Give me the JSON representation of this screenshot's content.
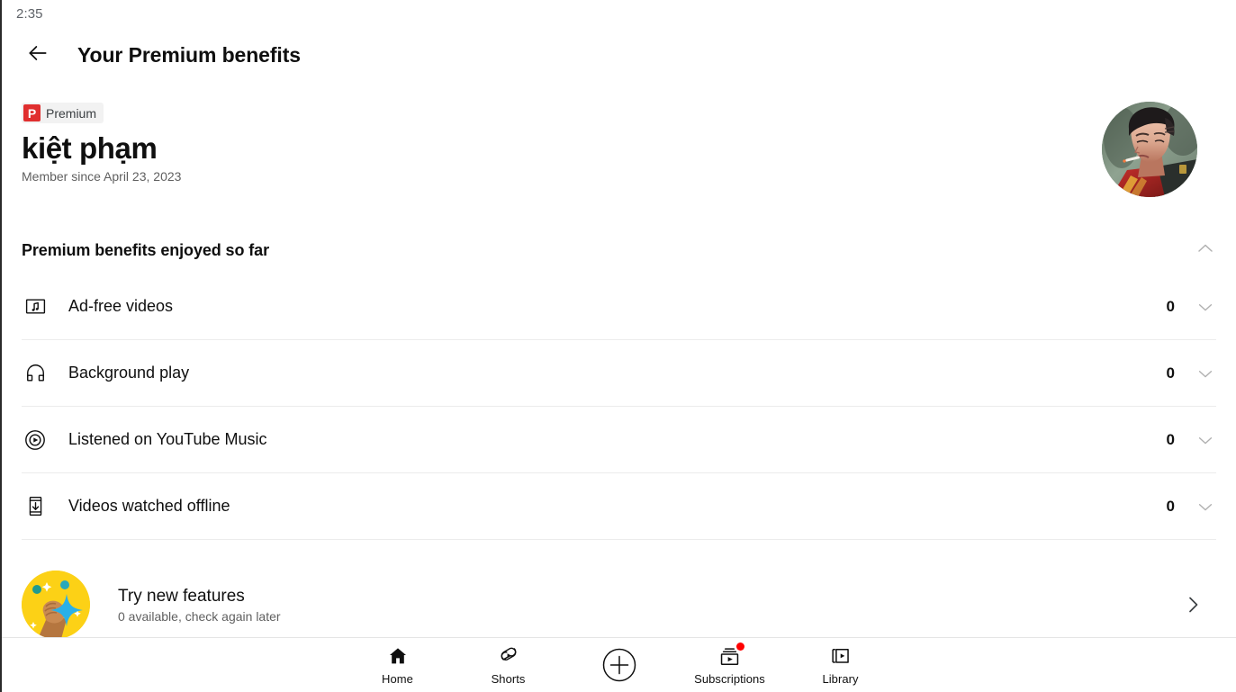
{
  "status_bar": {
    "time": "2:35"
  },
  "app_bar": {
    "back_icon": "arrow-left-icon",
    "title": "Your Premium benefits"
  },
  "profile": {
    "badge": {
      "logo_letter": "P",
      "label": "Premium",
      "logo_color": "#e02f2f",
      "pill_bg": "#f2f2f2"
    },
    "name": "kiệt phạm",
    "member_since": "Member since April 23, 2023",
    "avatar_alt": "user-avatar"
  },
  "benefits_section": {
    "title": "Premium benefits enjoyed so far",
    "collapse_icon": "chevron-up-icon",
    "rows": [
      {
        "icon": "ad-free-video-icon",
        "label": "Ad-free videos",
        "count": "0",
        "expand_icon": "chevron-down-icon"
      },
      {
        "icon": "headphones-icon",
        "label": "Background play",
        "count": "0",
        "expand_icon": "chevron-down-icon"
      },
      {
        "icon": "youtube-music-icon",
        "label": "Listened on YouTube Music",
        "count": "0",
        "expand_icon": "chevron-down-icon"
      },
      {
        "icon": "download-offline-icon",
        "label": "Videos watched offline",
        "count": "0",
        "expand_icon": "chevron-down-icon"
      }
    ]
  },
  "promo_card": {
    "art": "hand-sparkle-illustration",
    "title": "Try new features",
    "subtitle": "0 available, check again later",
    "chevron_icon": "chevron-right-icon"
  },
  "bottom_nav": {
    "items": [
      {
        "icon": "home-icon",
        "label": "Home",
        "badge": false
      },
      {
        "icon": "shorts-icon",
        "label": "Shorts",
        "badge": false
      },
      {
        "icon": "plus-circle-icon",
        "label": "",
        "badge": false
      },
      {
        "icon": "subscriptions-icon",
        "label": "Subscriptions",
        "badge": true
      },
      {
        "icon": "library-icon",
        "label": "Library",
        "badge": false
      }
    ],
    "badge_color": "#ff0000"
  }
}
